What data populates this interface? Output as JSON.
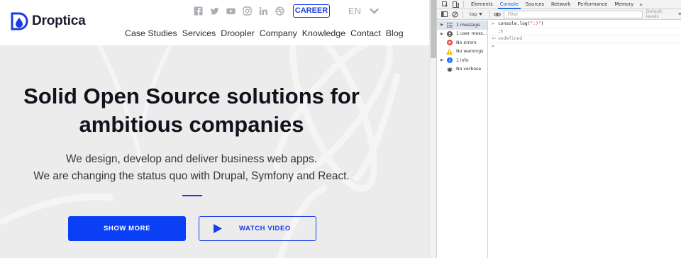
{
  "site": {
    "brand": "Droptica",
    "social_icons": [
      "facebook-icon",
      "twitter-icon",
      "youtube-icon",
      "instagram-icon",
      "linkedin-icon",
      "dribbble-icon"
    ],
    "career_label": "CAREER",
    "language": "EN",
    "nav": [
      "Case Studies",
      "Services",
      "Droopler",
      "Company",
      "Knowledge",
      "Contact",
      "Blog"
    ],
    "hero": {
      "title_line1": "Solid Open Source solutions for",
      "title_line2": "ambitious companies",
      "subtitle_line1": "We design, develop and deliver business web apps.",
      "subtitle_line2": "We are changing the status quo with Drupal, Symfony and React.",
      "primary_button": "SHOW MORE",
      "secondary_button": "WATCH VIDEO"
    },
    "colors": {
      "accent": "#0b3ff5",
      "hero_bg": "#ededed",
      "title": "#12121c"
    }
  },
  "devtools": {
    "tabs": [
      "Elements",
      "Console",
      "Sources",
      "Network",
      "Performance",
      "Memory"
    ],
    "active_tab": "Console",
    "more_tabs": "»",
    "context": "top",
    "filter_placeholder": "Filter",
    "levels_label": "Default levels",
    "sidebar": [
      {
        "label": "1 message",
        "icon": "list-icon",
        "expandable": true,
        "selected": true
      },
      {
        "label": "1 user mess...",
        "icon": "user-icon",
        "expandable": true,
        "selected": false
      },
      {
        "label": "No errors",
        "icon": "error-icon",
        "expandable": false,
        "selected": false
      },
      {
        "label": "No warnings",
        "icon": "warning-icon",
        "expandable": false,
        "selected": false
      },
      {
        "label": "1 info",
        "icon": "info-icon",
        "expandable": true,
        "selected": false
      },
      {
        "label": "No verbose",
        "icon": "verbose-icon",
        "expandable": false,
        "selected": false
      }
    ],
    "console": {
      "input_fn": "console.log(",
      "input_arg": "\":)\"",
      "input_close": ")",
      "output": ":)",
      "result": "undefined",
      "prompt_symbol": ">",
      "result_symbol": "<·"
    }
  }
}
